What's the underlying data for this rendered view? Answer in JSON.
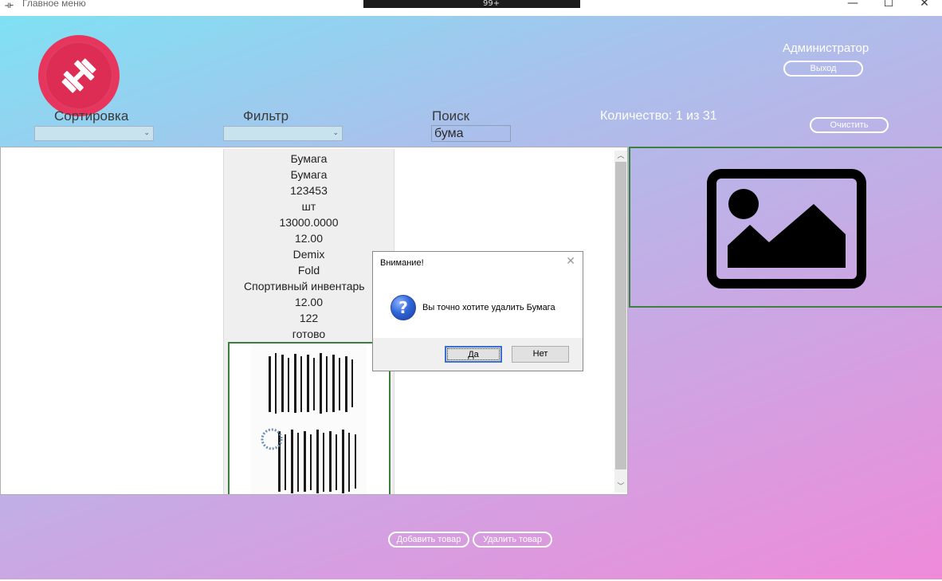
{
  "window": {
    "title": "Главное меню",
    "minimize_glyph": "—",
    "maximize_glyph": "☐",
    "close_glyph": "✕",
    "app_icon": "dumbbell-icon"
  },
  "overlay": {
    "badge": "99+"
  },
  "header": {
    "user_role": "Администратор",
    "logout_label": "Выход",
    "clear_label": "Очистить",
    "count_text": "Количество: 1 из 31"
  },
  "controls": {
    "sort_label": "Сортировка",
    "filter_label": "Фильтр",
    "search_label": "Поиск",
    "search_value": "бума",
    "sort_value": "",
    "filter_value": ""
  },
  "product": {
    "name": "Бумага",
    "type": "Бумага",
    "article": "123453",
    "unit": "шт",
    "price": "13000.0000",
    "discount": "12.00",
    "manufacturer": "Demix",
    "supplier": "Fold",
    "category": "Спортивный инвентарь",
    "max_discount": "12.00",
    "stock": "122",
    "status": "готово"
  },
  "buttons": {
    "add_label": "Добавить товар",
    "delete_label": "Удалить товар"
  },
  "dialog": {
    "title": "Внимание!",
    "message": "Вы точно хотите удалить Бумага",
    "yes_label": "Да",
    "no_label": "Нет",
    "close_glyph": "✕",
    "icon": "question-icon",
    "icon_glyph": "?"
  },
  "colors": {
    "gradient_start": "#7fe1f3",
    "gradient_end": "#ef8ad9",
    "logo_red": "#e7355e",
    "border_green": "#3d7d3f"
  }
}
